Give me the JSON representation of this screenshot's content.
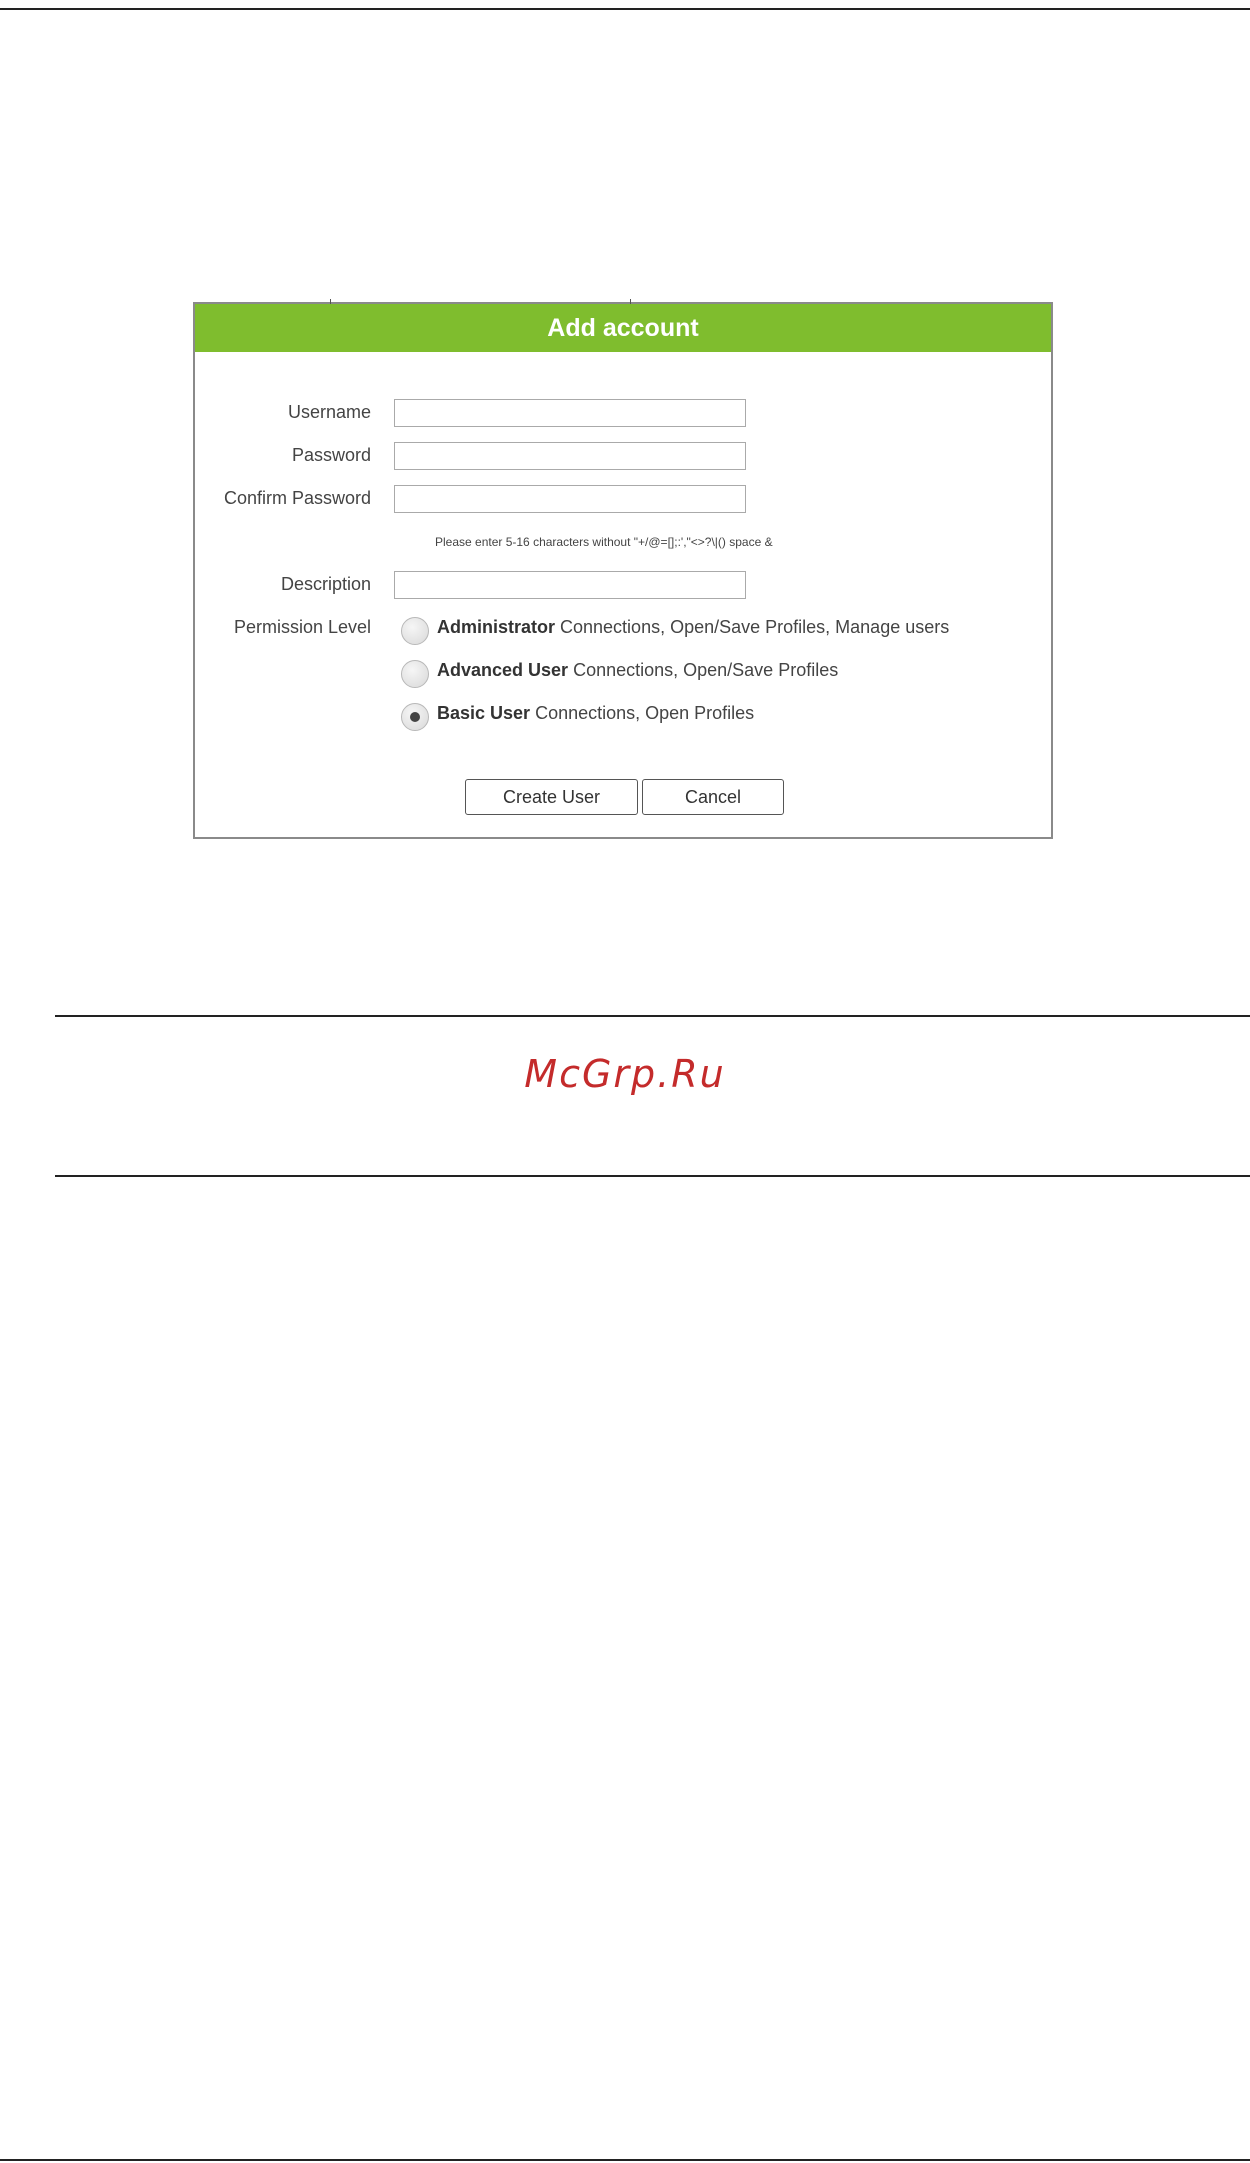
{
  "dialog": {
    "title": "Add account",
    "fields": [
      {
        "label": "Username",
        "value": ""
      },
      {
        "label": "Password",
        "value": ""
      },
      {
        "label": "Confirm Password",
        "value": ""
      }
    ],
    "hint": "Please enter 5-16 characters without \"+/@=[];:',\"<>?\\|() space &",
    "description": {
      "label": "Description",
      "value": ""
    },
    "permission": {
      "label": "Permission Level",
      "options": [
        {
          "name": "Administrator",
          "desc": " Connections, Open/Save Profiles, Manage users",
          "selected": false
        },
        {
          "name": "Advanced User",
          "desc": " Connections, Open/Save Profiles",
          "selected": false
        },
        {
          "name": "Basic User",
          "desc": " Connections, Open Profiles",
          "selected": true
        }
      ]
    },
    "buttons": {
      "create": "Create User",
      "cancel": "Cancel"
    }
  },
  "watermark": "McGrp.Ru"
}
